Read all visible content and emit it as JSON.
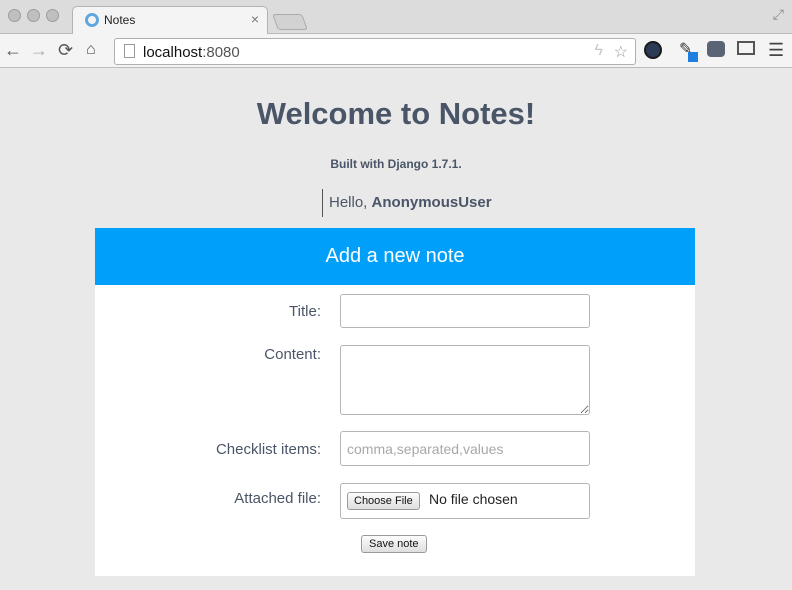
{
  "browser": {
    "tab_title": "Notes",
    "tab_close": "×",
    "url_host": "localhost",
    "url_port": ":8080",
    "icons": {
      "back": "←",
      "forward": "→",
      "reload": "⟳",
      "home": "⌂",
      "bolt": "ϟ",
      "star": "☆",
      "eyedropper": "✎",
      "menu": "☰",
      "fullscreen": "⤢"
    }
  },
  "page": {
    "title": "Welcome to Notes!",
    "built_with": "Built with Django 1.7.1.",
    "greeting_prefix": "Hello, ",
    "username": "AnonymousUser"
  },
  "form": {
    "header": "Add a new note",
    "title_label": "Title:",
    "title_value": "",
    "content_label": "Content:",
    "content_value": "",
    "checklist_label": "Checklist items:",
    "checklist_value": "",
    "checklist_placeholder": "comma,separated,values",
    "file_label": "Attached file:",
    "choose_file_label": "Choose File",
    "no_file_text": "No file chosen",
    "save_label": "Save note"
  },
  "colors": {
    "header_bg": "#00a0fa",
    "text": "#4a5567",
    "page_bg": "#e9e9e9"
  }
}
